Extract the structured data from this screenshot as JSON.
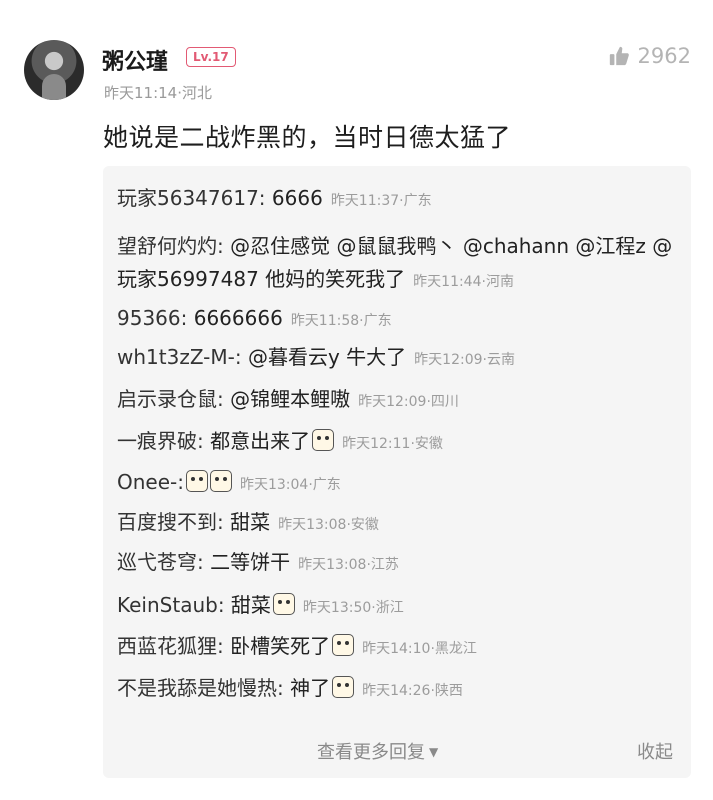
{
  "comment": {
    "username": "粥公瑾",
    "level": "Lv.17",
    "meta": "昨天11:14·河北",
    "likes": "2962",
    "text": "她说是二战炸黑的，当时日德太猛了"
  },
  "replies": [
    {
      "author": "玩家56347617:",
      "text": " 6666",
      "time": "昨天11:37·广东"
    },
    {
      "author": "望舒何灼灼:",
      "text": " @忍住感觉 @鼠鼠我鸭丶 @chahann @江程z @玩家56997487 他妈的笑死我了",
      "time": "昨天11:44·河南"
    },
    {
      "author": "95366:",
      "text": " 6666666",
      "time": "昨天11:58·广东"
    },
    {
      "author": "wh1t3zZ-M-:",
      "text": " @暮看云y 牛大了",
      "time": "昨天12:09·云南"
    },
    {
      "author": "启示录仓鼠:",
      "text": " @锦鲤本鲤嗷",
      "time": "昨天12:09·四川"
    },
    {
      "author": "一痕界破:",
      "text": " 都意出来了",
      "time": "昨天12:11·安徽"
    },
    {
      "author": "Onee-:",
      "text": "",
      "time": "昨天13:04·广东"
    },
    {
      "author": "百度搜不到:",
      "text": " 甜菜",
      "time": "昨天13:08·安徽"
    },
    {
      "author": "巡弋苍穹:",
      "text": " 二等饼干",
      "time": "昨天13:08·江苏"
    },
    {
      "author": "KeinStaub:",
      "text": " 甜菜",
      "time": "昨天13:50·浙江"
    },
    {
      "author": "西蓝花狐狸:",
      "text": " 卧槽笑死了",
      "time": "昨天14:10·黑龙江"
    },
    {
      "author": "不是我舔是她慢热:",
      "text": " 神了",
      "time": "昨天14:26·陕西"
    }
  ],
  "footer": {
    "more": "查看更多回复",
    "collapse": "收起"
  },
  "icons": {
    "like": "thumbs-up-icon",
    "expand": "chevron-down-icon",
    "sticker": "emoji-sticker-icon"
  },
  "colors": {
    "level_badge": "#e25a74",
    "reply_bg": "#f5f5f5",
    "meta_gray": "#9a9a9a"
  }
}
